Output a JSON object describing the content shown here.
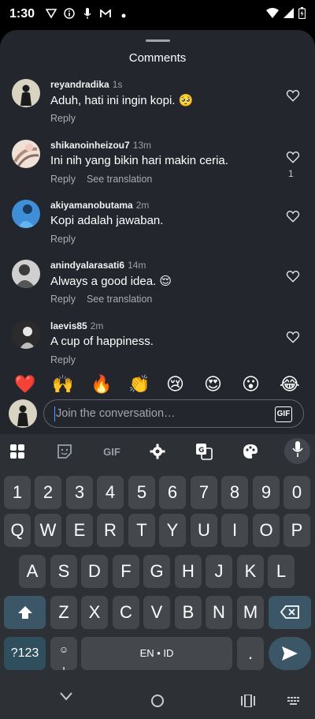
{
  "status": {
    "time": "1:30",
    "icons": [
      "vpn-icon",
      "info-icon",
      "mic-icon",
      "gmail-icon",
      "dot-icon"
    ],
    "right_icons": [
      "wifi-icon",
      "signal-icon",
      "battery-icon"
    ]
  },
  "sheet": {
    "title": "Comments"
  },
  "comments": [
    {
      "user": "reyandradika",
      "ago": "1s",
      "text": "Aduh, hati ini ingin kopi. 🥺",
      "reply": "Reply",
      "translate": "",
      "likes": ""
    },
    {
      "user": "shikanoinheizou7",
      "ago": "13m",
      "text": "Ini nih yang bikin hari makin ceria.",
      "reply": "Reply",
      "translate": "See translation",
      "likes": "1"
    },
    {
      "user": "akiyamanobutama",
      "ago": "2m",
      "text": "Kopi adalah jawaban.",
      "reply": "Reply",
      "translate": "",
      "likes": ""
    },
    {
      "user": "anindyalarasati6",
      "ago": "14m",
      "text": "Always a good idea. 😌",
      "reply": "Reply",
      "translate": "See translation",
      "likes": ""
    },
    {
      "user": "laevis85",
      "ago": "2m",
      "text": "A cup of happiness.",
      "reply": "Reply",
      "translate": "",
      "likes": ""
    }
  ],
  "emoji_bar": [
    "❤️",
    "🙌",
    "🔥",
    "👏",
    "😢",
    "😍",
    "😮",
    "😂"
  ],
  "compose": {
    "placeholder": "Join the conversation…",
    "gif_label": "GIF"
  },
  "keyboard": {
    "toolbar": [
      "apps-icon",
      "sticker-icon",
      "gif-icon",
      "settings-icon",
      "translate-icon",
      "palette-icon",
      "mic-icon"
    ],
    "toolbar_gif": "GIF",
    "row_numbers": [
      "1",
      "2",
      "3",
      "4",
      "5",
      "6",
      "7",
      "8",
      "9",
      "0"
    ],
    "row1": [
      "Q",
      "W",
      "E",
      "R",
      "T",
      "Y",
      "U",
      "I",
      "O",
      "P"
    ],
    "row2": [
      "A",
      "S",
      "D",
      "F",
      "G",
      "H",
      "J",
      "K",
      "L"
    ],
    "row3": [
      "Z",
      "X",
      "C",
      "V",
      "B",
      "N",
      "M"
    ],
    "symbols_key": "?123",
    "comma_key": ",",
    "space_label": "EN • ID",
    "period_key": "."
  },
  "nav": [
    "back-icon",
    "home-icon",
    "recents-icon",
    "keyboard-switch-icon"
  ],
  "colors": {
    "sheet_bg": "#23272d",
    "keyboard_bg": "#2d3035",
    "key_bg": "#44474c",
    "accent_key": "#3b5666"
  }
}
